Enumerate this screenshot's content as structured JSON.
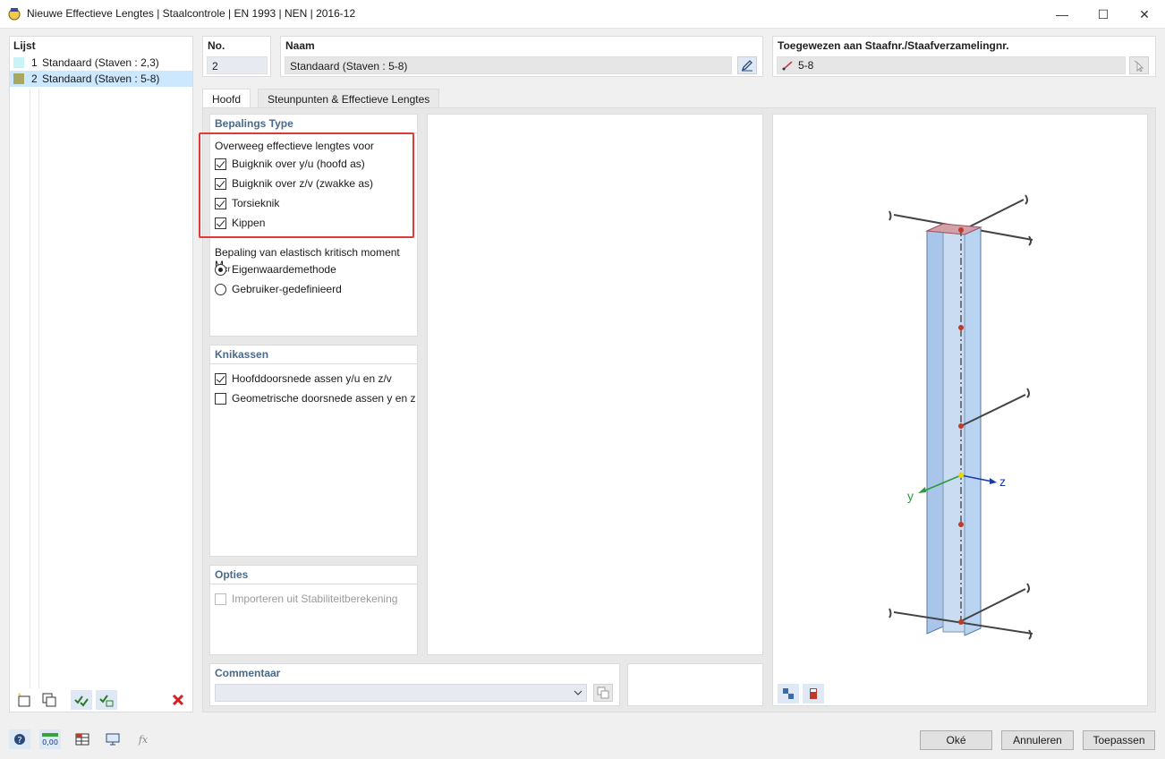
{
  "window": {
    "title": "Nieuwe Effectieve Lengtes | Staalcontrole | EN 1993 | NEN | 2016-12",
    "minimize": "—",
    "maximize": "☐",
    "close": "✕"
  },
  "list": {
    "header": "Lijst",
    "items": [
      {
        "num": "1",
        "label": "Standaard (Staven : 2,3)",
        "color": "#c8f4f8"
      },
      {
        "num": "2",
        "label": "Standaard (Staven : 5-8)",
        "color": "#a8a860"
      }
    ]
  },
  "fields": {
    "no_label": "No.",
    "no_value": "2",
    "name_label": "Naam",
    "name_value": "Standaard (Staven : 5-8)",
    "assigned_label": "Toegewezen aan Staafnr./Staafverzamelingnr.",
    "assigned_value": "5-8"
  },
  "tabs": [
    {
      "label": "Hoofd"
    },
    {
      "label": "Steunpunten & Effectieve Lengtes"
    }
  ],
  "bepalings": {
    "header": "Bepalings Type",
    "group_label": "Overweeg effectieve lengtes voor",
    "checks": [
      {
        "label": "Buigknik over y/u (hoofd as)"
      },
      {
        "label": "Buigknik over z/v (zwakke as)"
      },
      {
        "label": "Torsieknik"
      },
      {
        "label": "Kippen"
      }
    ],
    "moment_label": "Bepaling van elastisch kritisch moment M",
    "moment_sub": "cr",
    "radios": [
      {
        "label": "Eigenwaardemethode"
      },
      {
        "label": "Gebruiker-gedefinieerd"
      }
    ]
  },
  "knikassen": {
    "header": "Knikassen",
    "checks": [
      {
        "label": "Hoofddoorsnede assen y/u en z/v"
      },
      {
        "label": "Geometrische doorsnede assen y en z"
      }
    ]
  },
  "opties": {
    "header": "Opties",
    "check_label": "Importeren uit Stabiliteitberekening"
  },
  "commentaar": {
    "header": "Commentaar",
    "value": ""
  },
  "axes": {
    "y": "y",
    "z": "z"
  },
  "buttons": {
    "ok": "Oké",
    "cancel": "Annuleren",
    "apply": "Toepassen"
  },
  "colors": {
    "highlight_border": "#e0393b",
    "accent_blue": "#4a6a8a",
    "selection": "#cce8ff"
  }
}
